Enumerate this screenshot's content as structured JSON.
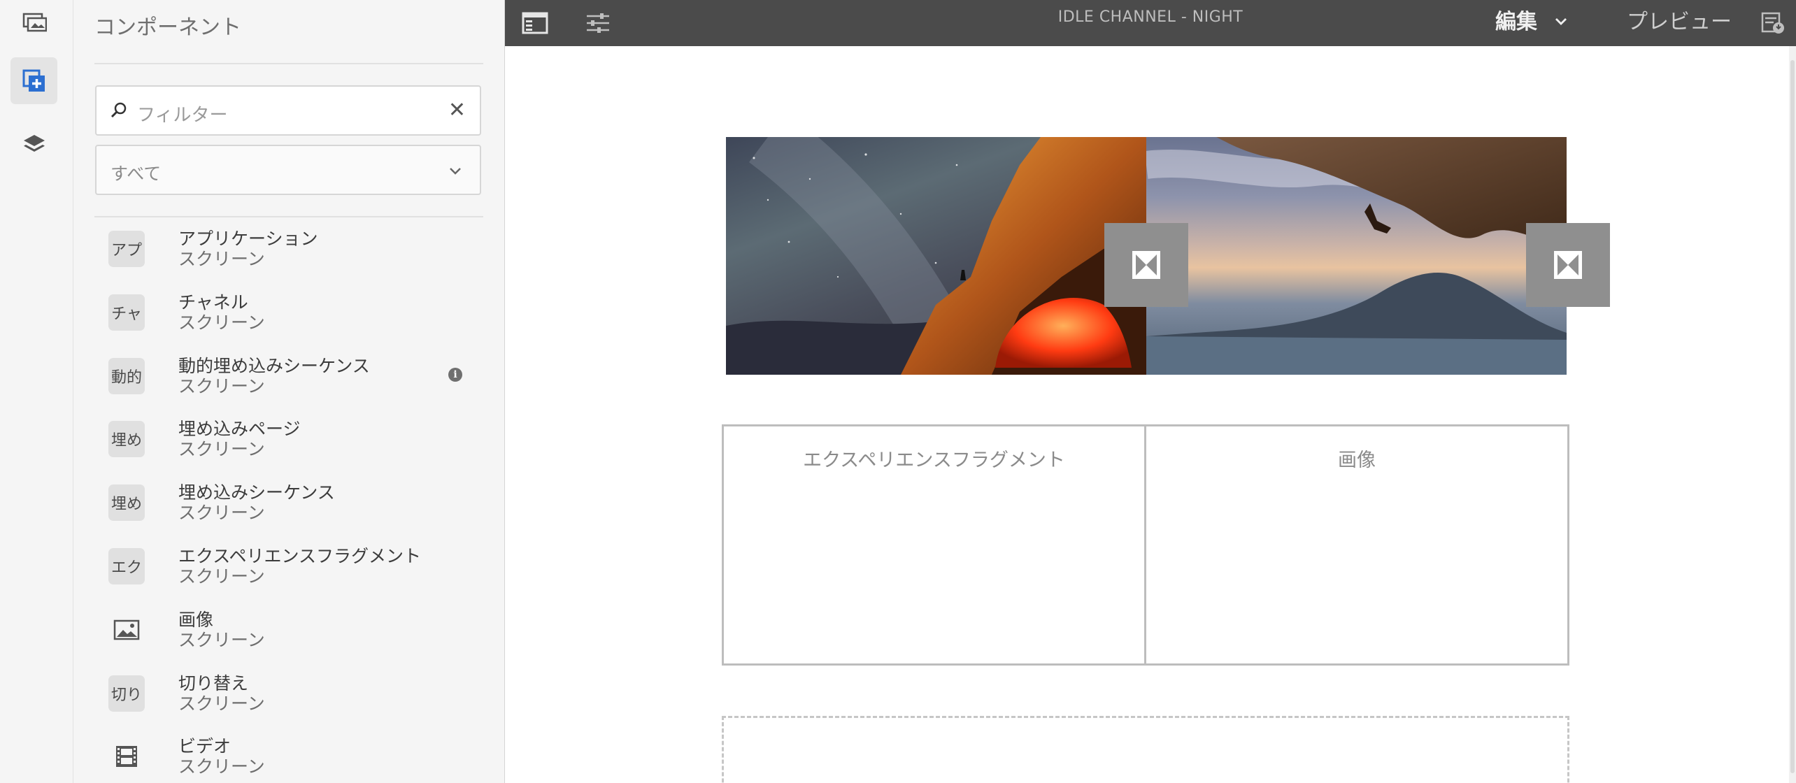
{
  "toolbar": {
    "title": "IDLE CHANNEL - NIGHT",
    "mode_label": "編集",
    "preview_label": "プレビュー"
  },
  "panel": {
    "title": "コンポーネント",
    "filter_placeholder": "フィルター",
    "category_value": "すべて",
    "items": [
      {
        "abbr": "アプ",
        "name": "アプリケーション",
        "group": "スクリーン"
      },
      {
        "abbr": "チャ",
        "name": "チャネル",
        "group": "スクリーン"
      },
      {
        "abbr": "動的",
        "name": "動的埋め込みシーケンス",
        "group": "スクリーン",
        "info": "i"
      },
      {
        "abbr": "埋め",
        "name": "埋め込みページ",
        "group": "スクリーン"
      },
      {
        "abbr": "埋め",
        "name": "埋め込みシーケンス",
        "group": "スクリーン"
      },
      {
        "abbr": "エク",
        "name": "エクスペリエンスフラグメント",
        "group": "スクリーン"
      },
      {
        "icon": "image-icon",
        "name": "画像",
        "group": "スクリーン"
      },
      {
        "abbr": "切り",
        "name": "切り替え",
        "group": "スクリーン"
      },
      {
        "icon": "film-icon",
        "name": "ビデオ",
        "group": "スクリーン"
      }
    ]
  },
  "canvas": {
    "grid_left_label": "エクスペリエンスフラグメント",
    "grid_right_label": "画像"
  },
  "colors": {
    "toolbar_bg": "#4b4b4b",
    "panel_bg": "#f5f5f5",
    "accent_blue": "#2c6fd1"
  }
}
